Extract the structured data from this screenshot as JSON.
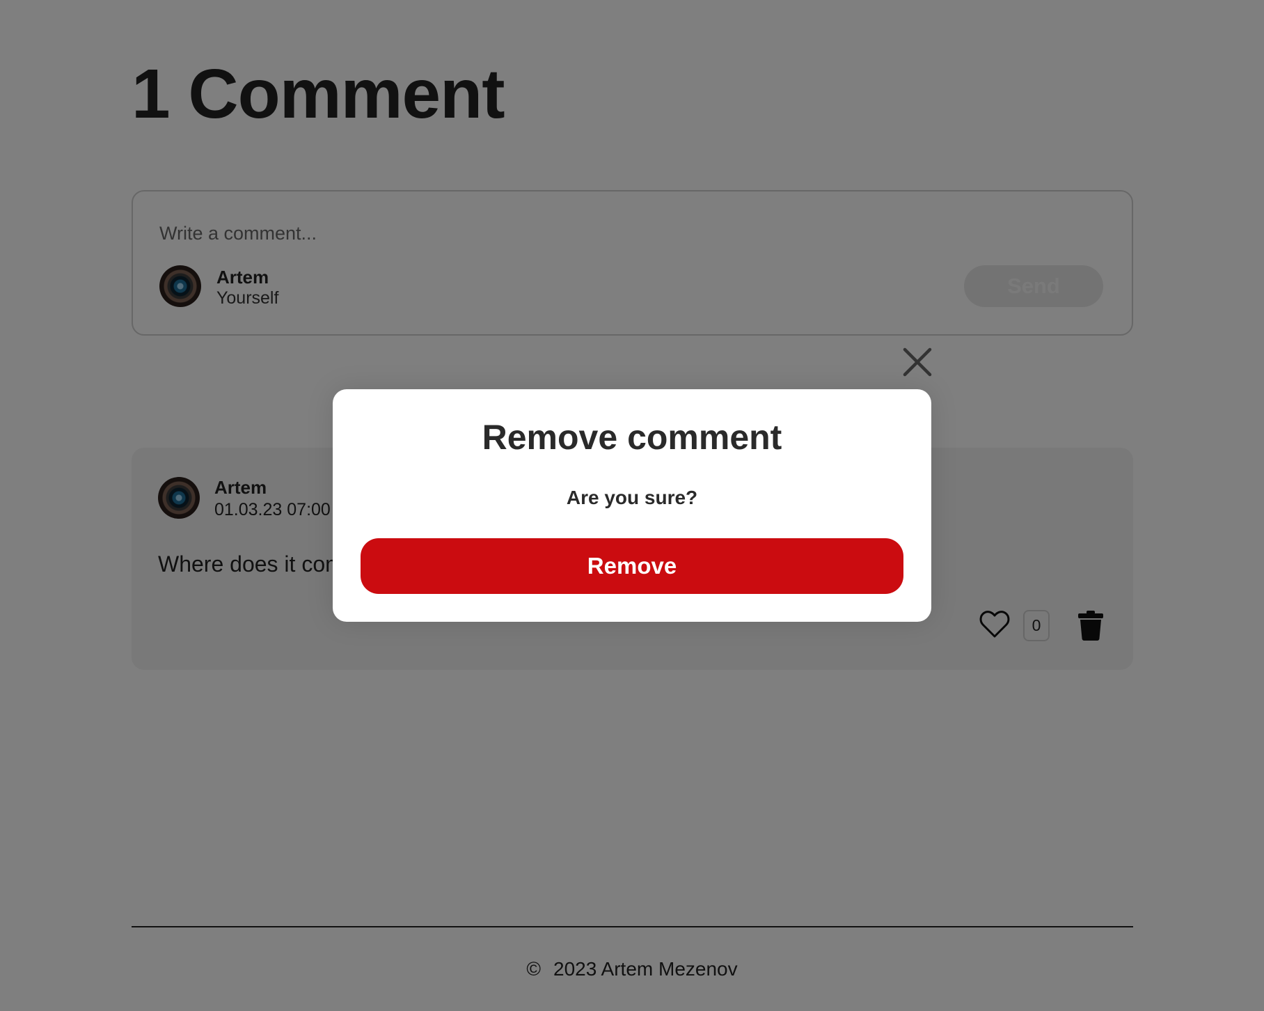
{
  "page": {
    "heading": "1 Comment"
  },
  "composer": {
    "placeholder": "Write a comment...",
    "user_name": "Artem",
    "user_sub": "Yourself",
    "send_label": "Send"
  },
  "comment": {
    "author": "Artem",
    "date": "01.03.23 07:00",
    "text": "Where does it come from?",
    "likes": "0"
  },
  "footer": {
    "copyright_symbol": "©",
    "text": "2023 Artem Mezenov"
  },
  "modal": {
    "title": "Remove comment",
    "subtitle": "Are you sure?",
    "remove_label": "Remove"
  },
  "colors": {
    "remove_button": "#cb0c10",
    "overlay": "rgba(0,0,0,0.5)"
  },
  "icons": [
    "avatar-image",
    "heart-icon",
    "trash-icon",
    "close-icon"
  ]
}
